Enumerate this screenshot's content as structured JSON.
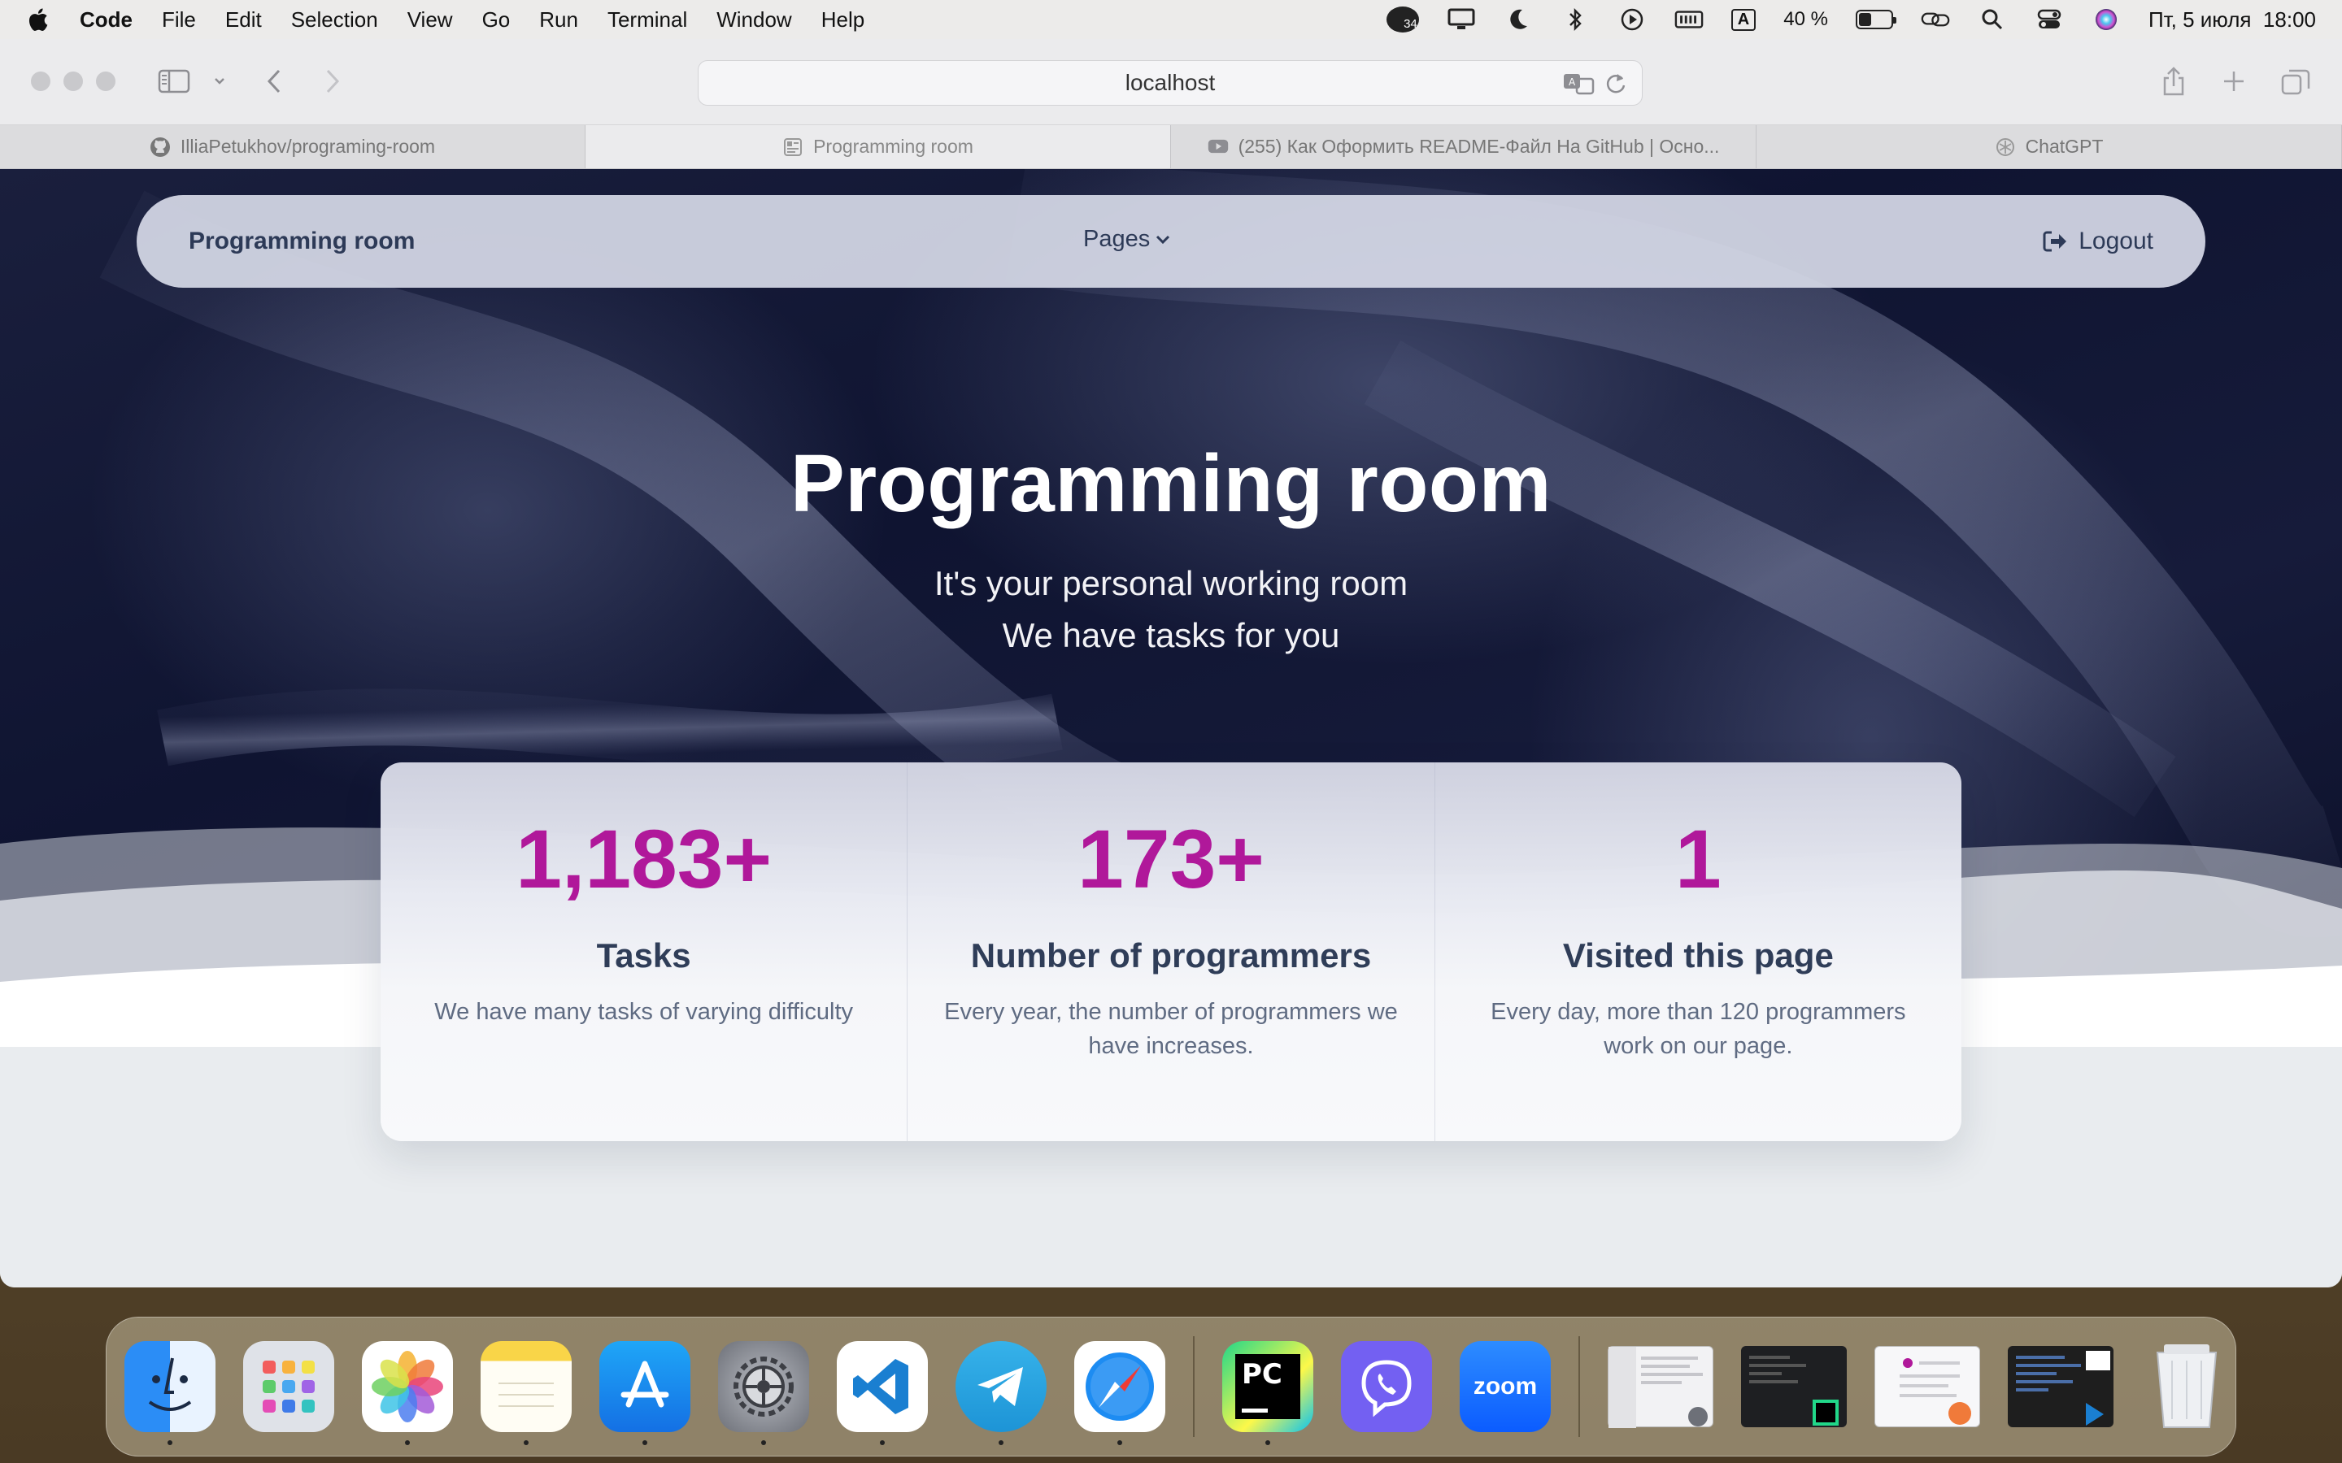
{
  "menubar": {
    "app_name": "Code",
    "items": [
      "File",
      "Edit",
      "Selection",
      "View",
      "Go",
      "Run",
      "Terminal",
      "Window",
      "Help"
    ],
    "notification_count": "34",
    "input_source": "A",
    "battery_percent": "40 %",
    "battery_level": 0.4,
    "datetime": "Пт, 5 июля  18:00"
  },
  "browser": {
    "address": "localhost",
    "tabs": [
      {
        "label": "IlliaPetukhov/programing-room",
        "icon": "github-icon"
      },
      {
        "label": "Programming room",
        "icon": "page-icon"
      },
      {
        "label": "(255) Как Оформить README-Файл На GitHub | Осно...",
        "icon": "youtube-icon"
      },
      {
        "label": "ChatGPT",
        "icon": "chatgpt-icon"
      }
    ],
    "active_tab": 1
  },
  "page": {
    "navbar": {
      "brand": "Programming room",
      "pages_label": "Pages",
      "logout_label": "Logout"
    },
    "hero": {
      "title": "Programming room",
      "subtitle_line1": "It's your personal working room",
      "subtitle_line2": "We have tasks for you"
    },
    "stats": [
      {
        "number": "1,183+",
        "label": "Tasks",
        "description": "We have many tasks of varying difficulty"
      },
      {
        "number": "173+",
        "label": "Number of programmers",
        "description": "Every year, the number of programmers we have increases."
      },
      {
        "number": "1",
        "label": "Visited this page",
        "description": "Every day, more than 120 programmers work on our page."
      }
    ],
    "accent_color": "#b0189a"
  },
  "dock": {
    "apps": [
      "Finder",
      "Launchpad",
      "Photos",
      "Notes",
      "App Store",
      "System Settings",
      "Visual Studio Code",
      "Telegram",
      "Safari",
      "PyCharm",
      "Viber",
      "Zoom"
    ],
    "zoom_label": "zoom",
    "pycharm_label": "PC"
  }
}
